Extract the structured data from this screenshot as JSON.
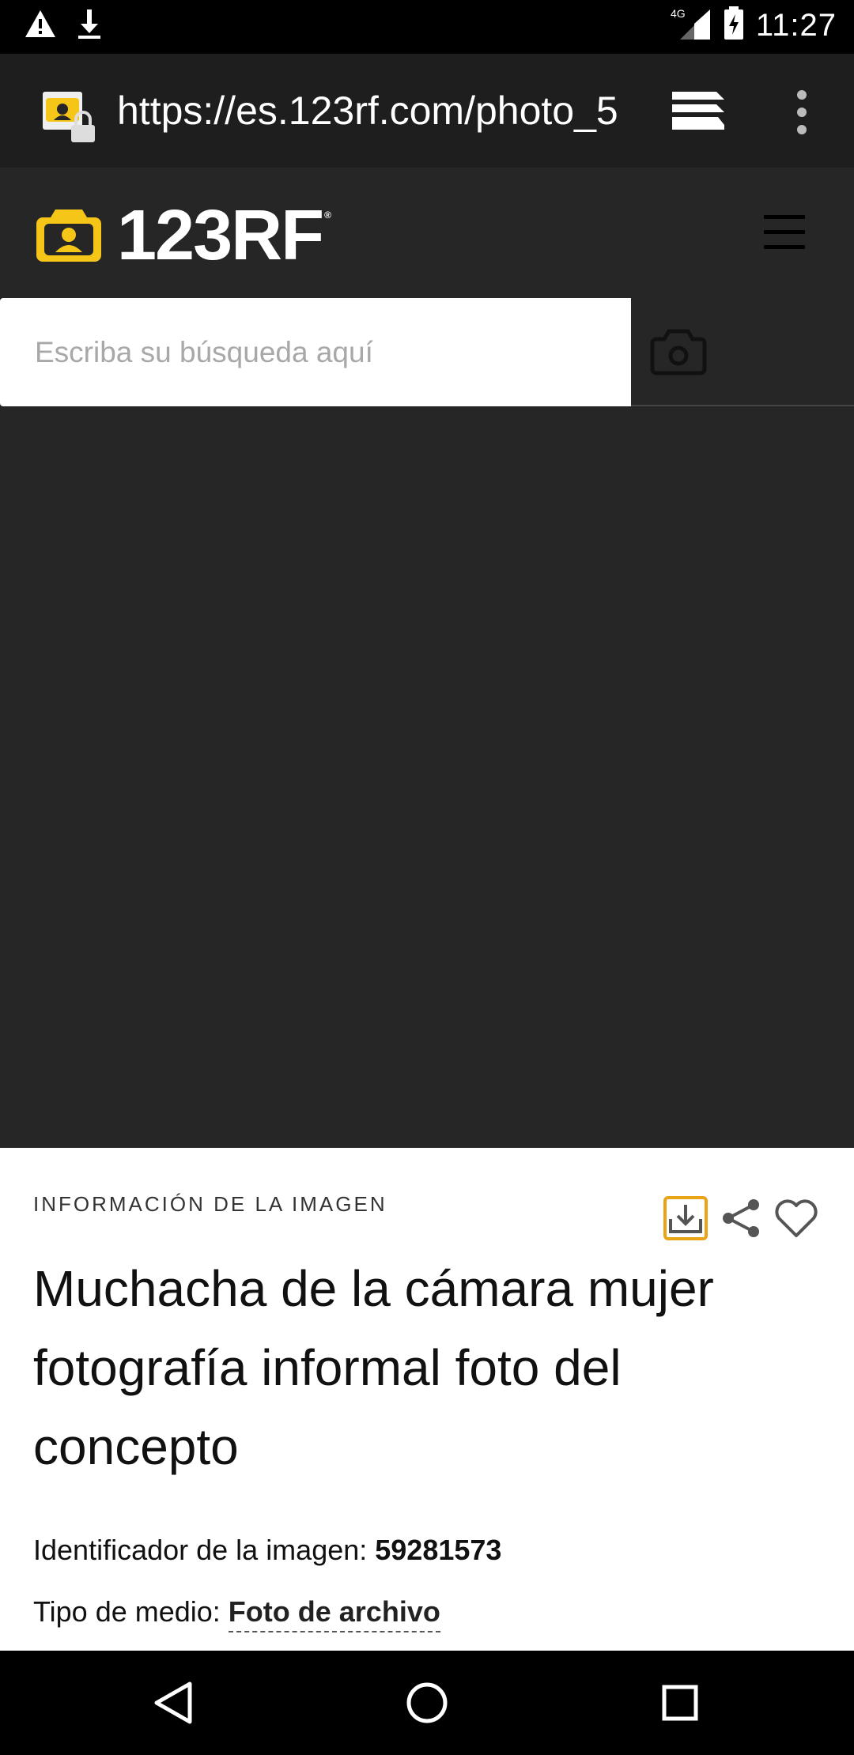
{
  "status_bar": {
    "time": "11:27",
    "network": "4G",
    "icons": [
      "warning-icon",
      "download-icon",
      "signal-icon",
      "battery-charging-icon"
    ]
  },
  "browser": {
    "url": "https://es.123rf.com/photo_5"
  },
  "site": {
    "logo_text": "123RF",
    "logo_mark": "®",
    "brand_color": "#f5c518",
    "search_placeholder": "Escriba su búsqueda aquí"
  },
  "info": {
    "heading": "INFORMACIÓN DE LA IMAGEN",
    "title": "Muchacha de la cámara mujer fotografía informal foto del concepto",
    "id_label": "Identificador de la imagen: ",
    "id_value": "59281573",
    "media_label": "Tipo de medio: ",
    "media_value": "Foto de archivo"
  }
}
